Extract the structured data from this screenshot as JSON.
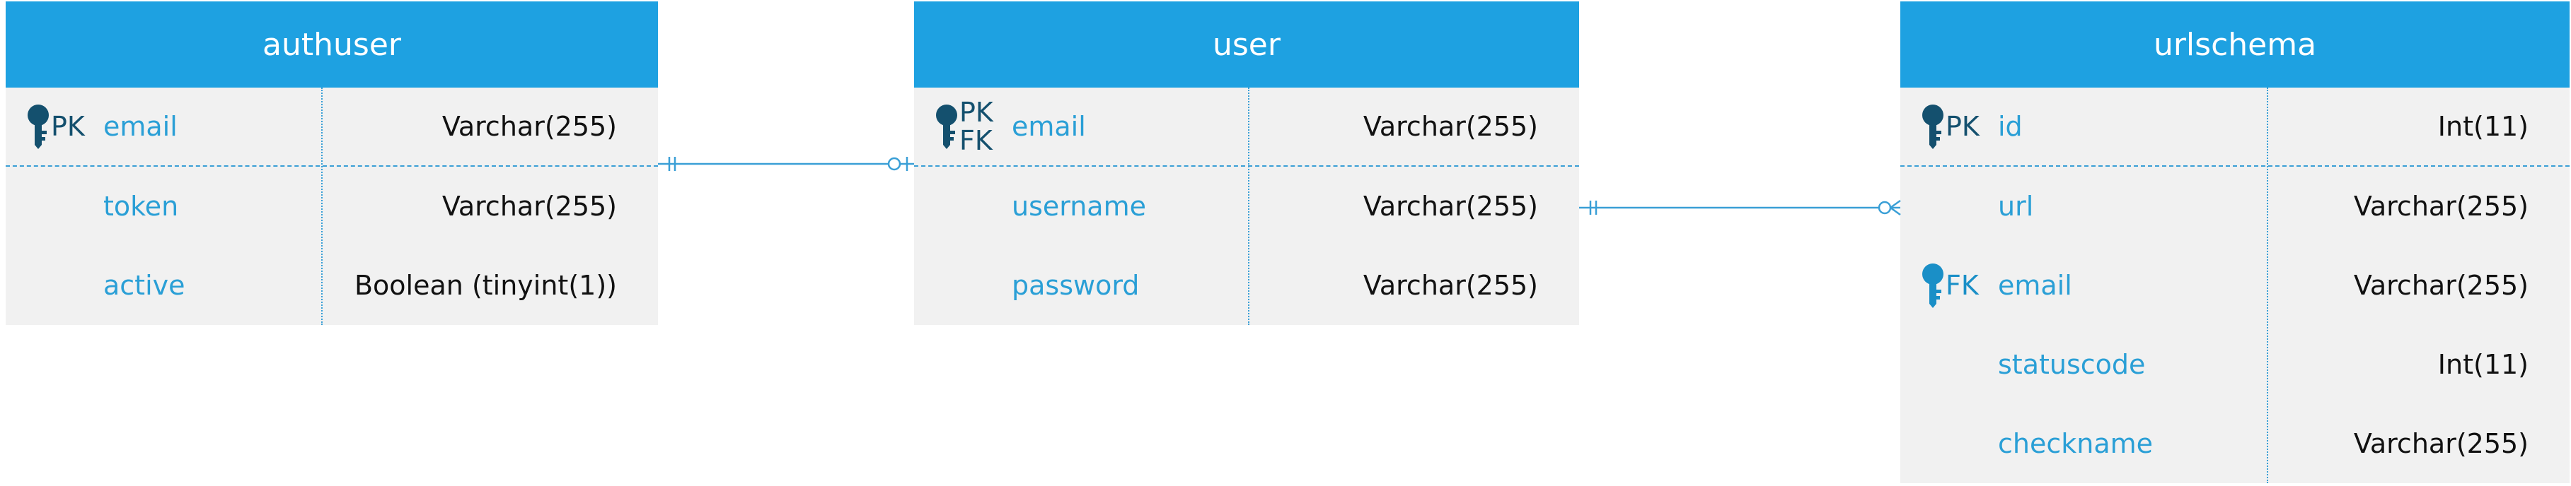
{
  "entities": [
    {
      "name": "authuser",
      "fields": [
        {
          "key": "PK",
          "name": "email",
          "type": "Varchar(255)"
        },
        {
          "key": "",
          "name": "token",
          "type": "Varchar(255)"
        },
        {
          "key": "",
          "name": "active",
          "type": "Boolean (tinyint(1))"
        }
      ]
    },
    {
      "name": "user",
      "fields": [
        {
          "key": "PK\nFK",
          "name": "email",
          "type": "Varchar(255)"
        },
        {
          "key": "",
          "name": "username",
          "type": "Varchar(255)"
        },
        {
          "key": "",
          "name": "password",
          "type": "Varchar(255)"
        }
      ]
    },
    {
      "name": "urlschema",
      "fields": [
        {
          "key": "PK",
          "name": "id",
          "type": "Int(11)"
        },
        {
          "key": "",
          "name": "url",
          "type": "Varchar(255)"
        },
        {
          "key": "FK",
          "name": "email",
          "type": "Varchar(255)"
        },
        {
          "key": "",
          "name": "statuscode",
          "type": "Int(11)"
        },
        {
          "key": "",
          "name": "checkname",
          "type": "Varchar(255)"
        }
      ]
    }
  ],
  "relationships": [
    {
      "from": "authuser",
      "to": "user",
      "from_end": "one-and-only-one",
      "to_end": "zero-or-one"
    },
    {
      "from": "user",
      "to": "urlschema",
      "from_end": "one-and-only-one",
      "to_end": "zero-or-many"
    }
  ],
  "colors": {
    "header": "#1ea1e1",
    "field_name": "#2a9fd6",
    "key": "#14506e",
    "line": "#3a9fd6"
  },
  "icons": {
    "key": "key-icon"
  }
}
